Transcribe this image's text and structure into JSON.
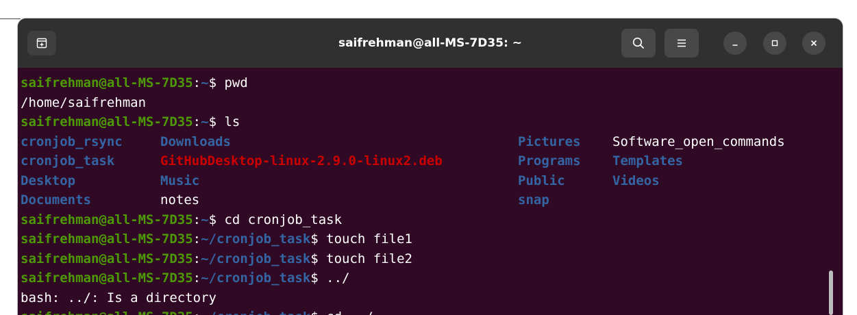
{
  "window": {
    "title": "saifrehman@all-MS-7D35: ~"
  },
  "icons": {
    "new_tab": "new-tab-icon",
    "search": "search-icon",
    "menu": "hamburger-menu-icon",
    "minimize": "minimize-icon",
    "maximize": "maximize-icon",
    "close": "close-icon"
  },
  "colors": {
    "terminal_bg": "#300a24",
    "titlebar_bg": "#303030",
    "prompt_user": "#4e9a06",
    "prompt_path": "#3465a4",
    "directory": "#3465a4",
    "archive": "#cc0000",
    "text": "#ffffff"
  },
  "terminal": {
    "prompt": {
      "user_host": "saifrehman@all-MS-7D35",
      "sep": ":",
      "home_path": "~",
      "task_path": "~/cronjob_task",
      "dollar": "$ "
    },
    "commands": {
      "pwd": "pwd",
      "ls": "ls",
      "cd_task": "cd cronjob_task",
      "touch1": "touch file1",
      "touch2": "touch file2",
      "dotdot": "../",
      "cd_up": "cd ../"
    },
    "outputs": {
      "pwd": "/home/saifrehman",
      "bash_error": "bash: ../: Is a directory"
    },
    "ls_rows": [
      [
        "cronjob_rsync",
        "Downloads",
        "Pictures",
        "Software_open_commands"
      ],
      [
        "cronjob_task",
        "GitHubDesktop-linux-2.9.0-linux2.deb",
        "Programs",
        "Templates"
      ],
      [
        "Desktop",
        "Music",
        "Public",
        "Videos"
      ],
      [
        "Documents",
        "notes",
        "snap",
        ""
      ]
    ]
  }
}
